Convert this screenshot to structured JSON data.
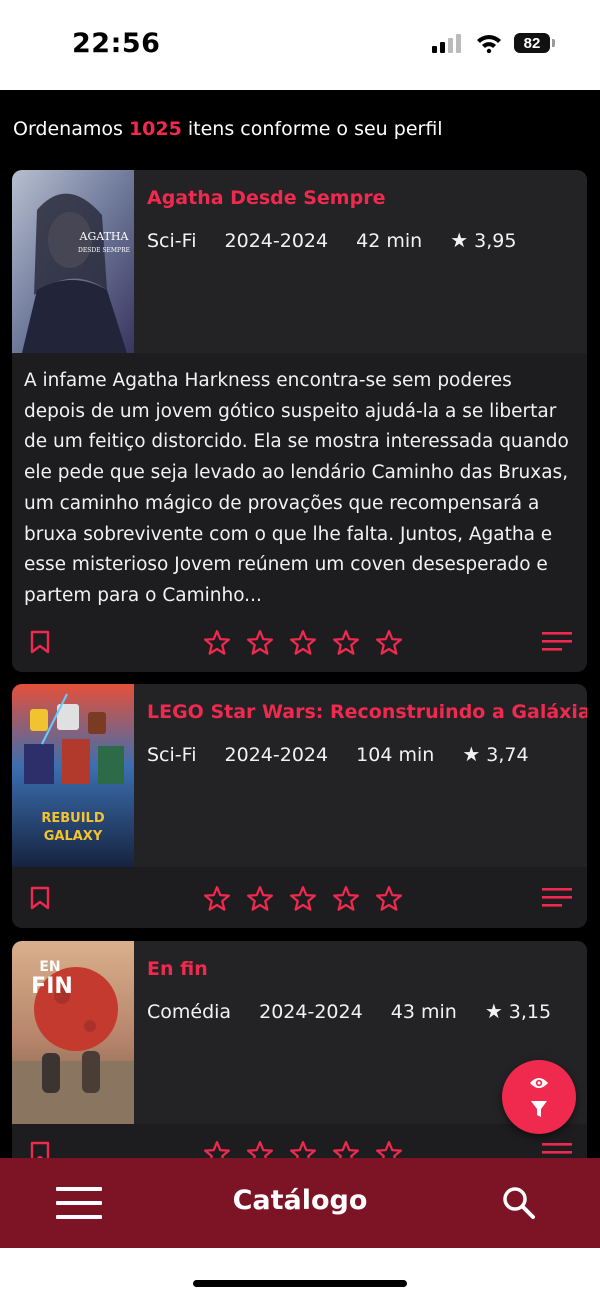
{
  "status_bar": {
    "time": "22:56",
    "battery": "82"
  },
  "summary": {
    "prefix": "Ordenamos",
    "count": "1025",
    "suffix": "itens conforme o seu perfil"
  },
  "items": [
    {
      "title": "Agatha Desde Sempre",
      "genre": "Sci-Fi",
      "years": "2024-2024",
      "duration": "42 min",
      "rating": "3,95",
      "synopsis": "A infame Agatha Harkness encontra-se sem poderes depois de um jovem gótico suspeito ajudá-la a se libertar de um feitiço distorcido. Ela se mostra interessada quando ele pede que seja levado ao lendário Caminho das Bruxas, um caminho mágico de provações que recompensará a bruxa sobrevivente com o que lhe falta. Juntos, Agatha e esse misterioso Jovem reúnem um coven desesperado e partem para o Caminho...",
      "poster_text": "AGATHA\nDESDE SEMPRE"
    },
    {
      "title": "LEGO Star Wars: Reconstruindo a Galáxia",
      "genre": "Sci-Fi",
      "years": "2024-2024",
      "duration": "104 min",
      "rating": "3,74",
      "poster_text": "REBUILD\nGALAXY"
    },
    {
      "title": "En fin",
      "genre": "Comédia",
      "years": "2024-2024",
      "duration": "43 min",
      "rating": "3,15",
      "poster_text": "EN\nFIN"
    }
  ],
  "bottom_bar": {
    "title": "Catálogo"
  },
  "colors": {
    "accent": "#f0294f",
    "card": "#1d1d1f",
    "bar": "#7d1425"
  },
  "icons": [
    "signal-icon",
    "wifi-icon",
    "battery-icon",
    "bookmark-icon",
    "star-icon",
    "list-icon",
    "eye-icon",
    "filter-icon",
    "hamburger-icon",
    "search-icon"
  ]
}
